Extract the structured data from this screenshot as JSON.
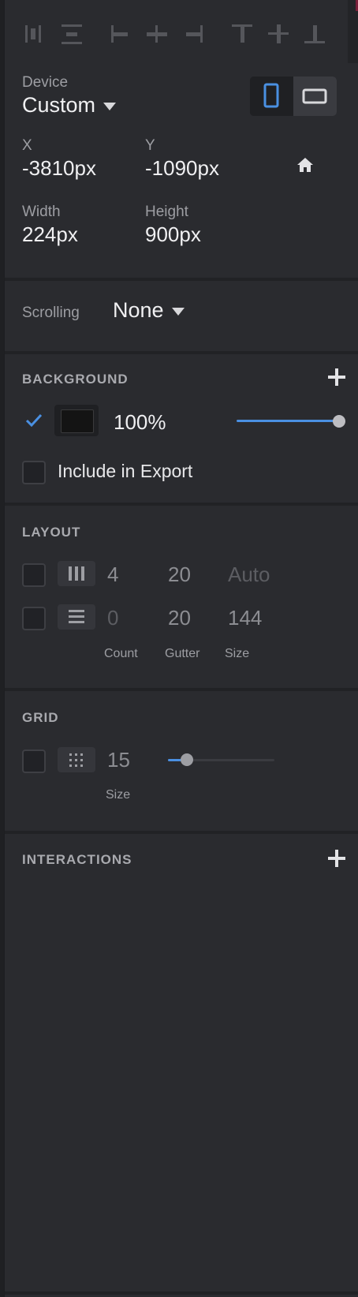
{
  "device": {
    "label": "Device",
    "value": "Custom",
    "orientation_selected": "portrait"
  },
  "position": {
    "x_label": "X",
    "x_value": "-3810px",
    "y_label": "Y",
    "y_value": "-1090px"
  },
  "size": {
    "width_label": "Width",
    "width_value": "224px",
    "height_label": "Height",
    "height_value": "900px"
  },
  "scrolling": {
    "label": "Scrolling",
    "value": "None"
  },
  "background": {
    "title": "BACKGROUND",
    "enabled": true,
    "color": "#141414",
    "opacity_text": "100%",
    "opacity_fraction": 1.0,
    "include_export_label": "Include in Export",
    "include_export_checked": false
  },
  "layout": {
    "title": "LAYOUT",
    "columns": {
      "count": "4",
      "gutter": "20",
      "size": "Auto"
    },
    "rows": {
      "count": "0",
      "gutter": "20",
      "size": "144"
    },
    "count_label": "Count",
    "gutter_label": "Gutter",
    "size_label": "Size"
  },
  "grid": {
    "title": "GRID",
    "value": "15",
    "size_label": "Size",
    "slider_fraction": 0.17
  },
  "interactions": {
    "title": "INTERACTIONS"
  },
  "colors": {
    "accent": "#4a90e2",
    "panel": "#2a2b2f"
  },
  "icons": {
    "align": [
      "align-left-icon",
      "align-horizontal-distribute-icon",
      "align-left-edge-icon",
      "align-center-horizontal-icon",
      "align-right-icon",
      "align-top-icon",
      "align-middle-vertical-icon",
      "align-bottom-icon"
    ],
    "home": "home-icon",
    "columns": "columns-icon",
    "rows": "rows-icon",
    "grid": "grid-dots-icon"
  }
}
